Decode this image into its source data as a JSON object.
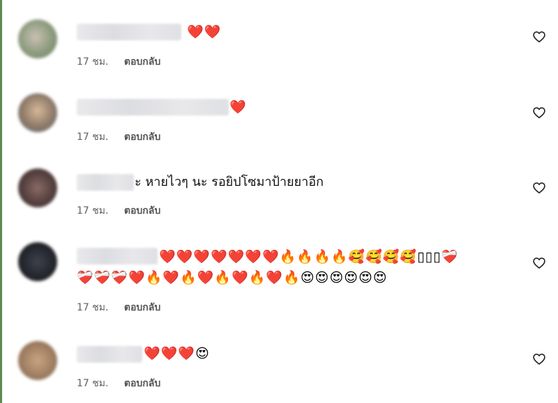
{
  "comments": [
    {
      "text": "",
      "emoji": [
        "❤️",
        "❤️"
      ],
      "emoji2": [],
      "time": "17 ชม.",
      "reply_label": "ตอบกลับ",
      "avatar_color": "#7a8a6e"
    },
    {
      "text": "",
      "emoji": [
        "❤️"
      ],
      "emoji2": [],
      "time": "17 ชม.",
      "reply_label": "ตอบกลับ",
      "avatar_color": "#7c6d5e"
    },
    {
      "text": "ะ หายไวๆ นะ รอยิปโซมาป้ายยาอีก",
      "emoji": [],
      "emoji2": [],
      "time": "17 ชม.",
      "reply_label": "ตอบกลับ",
      "avatar_color": "#4a3e3c"
    },
    {
      "text": "",
      "emoji": [
        "❤️",
        "❤️",
        "❤️",
        "❤️",
        "❤️",
        "❤️",
        "❤️",
        "🔥",
        "🔥",
        "🔥",
        "🔥",
        "🥰",
        "🥰",
        "🥰",
        "🥰",
        "▯",
        "▯",
        "▯",
        "❤️‍🩹"
      ],
      "emoji2": [
        "❤️‍🩹",
        "❤️‍🩹",
        "❤️‍🩹",
        "❤️",
        "🔥",
        "❤️",
        "🔥",
        "❤️",
        "🔥",
        "❤️",
        "🔥",
        "❤️",
        "🔥",
        "😍",
        "😍",
        "😍",
        "😍",
        "😍",
        "😍"
      ],
      "time": "17 ชม.",
      "reply_label": "ตอบกลับ",
      "avatar_color": "#23252d"
    },
    {
      "text": "",
      "emoji": [
        "❤️",
        "❤️",
        "❤️",
        "😍"
      ],
      "emoji2": [],
      "time": "17 ชม.",
      "reply_label": "ตอบกลับ",
      "avatar_color": "#9a7a5e"
    }
  ],
  "colors": {
    "meta_text": "#606060",
    "comment_text": "#101010",
    "heart_stroke": "#262626",
    "left_edge": "#5d8a4e"
  },
  "icons": {
    "like": "heart-outline-icon"
  }
}
